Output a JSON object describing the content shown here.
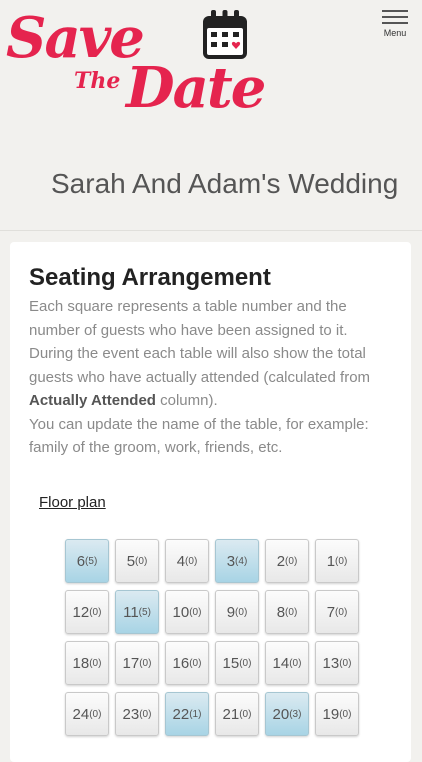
{
  "header": {
    "logo": {
      "save": "Save",
      "the": "The",
      "date": "Date"
    },
    "menu_label": "Menu",
    "wedding_title": "Sarah And Adam's Wedding"
  },
  "seating": {
    "title": "Seating Arrangement",
    "desc_1": "Each square represents a table number and the number of guests who have been assigned to it. During the event each table will also show the total guests who have actually attended (calculated from ",
    "desc_bold": "Actually Attended",
    "desc_2": " column).",
    "desc_3": "You can update the name of the table, for example: family of the groom, work, friends, etc.",
    "floor_plan_link": "Floor plan",
    "tables": [
      {
        "number": "6",
        "guests": "(5)",
        "assigned": true
      },
      {
        "number": "5",
        "guests": "(0)",
        "assigned": false
      },
      {
        "number": "4",
        "guests": "(0)",
        "assigned": false
      },
      {
        "number": "3",
        "guests": "(4)",
        "assigned": true
      },
      {
        "number": "2",
        "guests": "(0)",
        "assigned": false
      },
      {
        "number": "1",
        "guests": "(0)",
        "assigned": false
      },
      {
        "number": "12",
        "guests": "(0)",
        "assigned": false
      },
      {
        "number": "11",
        "guests": "(5)",
        "assigned": true
      },
      {
        "number": "10",
        "guests": "(0)",
        "assigned": false
      },
      {
        "number": "9",
        "guests": "(0)",
        "assigned": false
      },
      {
        "number": "8",
        "guests": "(0)",
        "assigned": false
      },
      {
        "number": "7",
        "guests": "(0)",
        "assigned": false
      },
      {
        "number": "18",
        "guests": "(0)",
        "assigned": false
      },
      {
        "number": "17",
        "guests": "(0)",
        "assigned": false
      },
      {
        "number": "16",
        "guests": "(0)",
        "assigned": false
      },
      {
        "number": "15",
        "guests": "(0)",
        "assigned": false
      },
      {
        "number": "14",
        "guests": "(0)",
        "assigned": false
      },
      {
        "number": "13",
        "guests": "(0)",
        "assigned": false
      },
      {
        "number": "24",
        "guests": "(0)",
        "assigned": false
      },
      {
        "number": "23",
        "guests": "(0)",
        "assigned": false
      },
      {
        "number": "22",
        "guests": "(1)",
        "assigned": true
      },
      {
        "number": "21",
        "guests": "(0)",
        "assigned": false
      },
      {
        "number": "20",
        "guests": "(3)",
        "assigned": true
      },
      {
        "number": "19",
        "guests": "(0)",
        "assigned": false
      }
    ]
  },
  "colors": {
    "brand": "#e5244e",
    "assigned_table": "#a8d4e5",
    "page_bg": "#f2f1ee"
  },
  "icons": [
    "calendar-heart-icon",
    "hamburger-menu-icon"
  ]
}
